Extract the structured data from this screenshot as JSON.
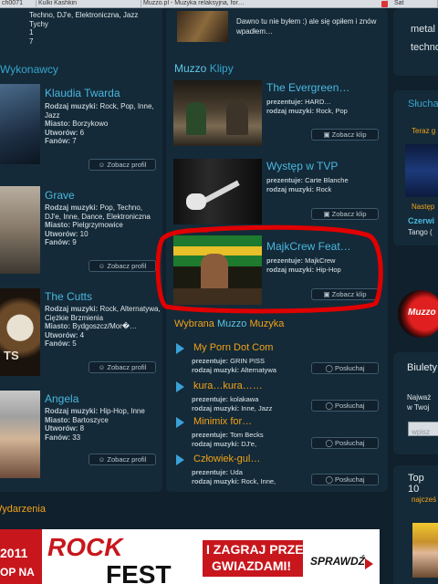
{
  "browser": {
    "tabs": [
      "ch0071",
      "Kulki Kashkin",
      "Muzzo.pl - Muzyka relaksyjna, for…",
      "Sat"
    ]
  },
  "top_left": {
    "lines": [
      "Techno, DJ'e, Elektroniczna, Jazz",
      "Tychy",
      "1",
      "7"
    ]
  },
  "top_middle": {
    "text": "Dawno tu nie byłem :) ale się opiłem i znów wpadłem…"
  },
  "right_top": {
    "lines": [
      "metal",
      "techno"
    ]
  },
  "artists": {
    "heading": "Wykonawcy",
    "items": [
      {
        "name": "Klaudia Twarda",
        "rows": [
          {
            "k": "Rodzaj muzyki:",
            "v": "Rock, Pop, Inne, Jazz"
          },
          {
            "k": "Miasto:",
            "v": "Borzykowo"
          },
          {
            "k": "Utworów:",
            "v": "6"
          },
          {
            "k": "Fanów:",
            "v": "7"
          }
        ],
        "button": "Zobacz profil"
      },
      {
        "name": "Grave",
        "rows": [
          {
            "k": "Rodzaj muzyki:",
            "v": "Pop, Techno, DJ'e, Inne, Dance, Elektroniczna"
          },
          {
            "k": "Miasto:",
            "v": "Pielgrzymowice"
          },
          {
            "k": "Utworów:",
            "v": "10"
          },
          {
            "k": "Fanów:",
            "v": "9"
          }
        ],
        "button": "Zobacz profil"
      },
      {
        "name": "The Cutts",
        "rows": [
          {
            "k": "Rodzaj muzyki:",
            "v": "Rock, Alternatywa, Ciężkie Brzmienia"
          },
          {
            "k": "Miasto:",
            "v": "Bydgoszcz/Mor�…"
          },
          {
            "k": "Utworów:",
            "v": "4"
          },
          {
            "k": "Fanów:",
            "v": "5"
          }
        ],
        "button": "Zobacz profil"
      },
      {
        "name": "Angela",
        "rows": [
          {
            "k": "Rodzaj muzyki:",
            "v": "Hip-Hop, Inne"
          },
          {
            "k": "Miasto:",
            "v": "Bartoszyce"
          },
          {
            "k": "Utworów:",
            "v": "8"
          },
          {
            "k": "Fanów:",
            "v": "33"
          }
        ],
        "button": "Zobacz profil"
      }
    ]
  },
  "clips": {
    "heading_a": "Muzzo",
    "heading_b": "Klipy",
    "items": [
      {
        "title": "The Evergreen…",
        "rows": [
          {
            "k": "prezentuje:",
            "v": "HARD…"
          },
          {
            "k": "rodzaj muzyki:",
            "v": "Rock, Pop"
          }
        ],
        "button": "Zobacz klip"
      },
      {
        "title": "Występ w TVP",
        "rows": [
          {
            "k": "prezentuje:",
            "v": "Carte Blanche"
          },
          {
            "k": "rodzaj muzyki:",
            "v": "Rock"
          }
        ],
        "button": "Zobacz klip"
      },
      {
        "title": "MajkCrew Feat…",
        "rows": [
          {
            "k": "prezentuje:",
            "v": "MajkCrew"
          },
          {
            "k": "rodzaj muzyki:",
            "v": "Hip-Hop"
          }
        ],
        "button": "Zobacz klip"
      }
    ]
  },
  "music": {
    "heading_a": "Wybrana",
    "heading_b": "Muzzo",
    "heading_c": "Muzyka",
    "items": [
      {
        "title": "My Porn Dot Com",
        "rows": [
          {
            "k": "prezentuje:",
            "v": "GRIN PISS"
          },
          {
            "k": "rodzaj muzyki:",
            "v": "Alternatywa"
          }
        ],
        "button": "Posłuchaj"
      },
      {
        "title": "kura…kura……",
        "rows": [
          {
            "k": "prezentuje:",
            "v": "kolakawa"
          },
          {
            "k": "rodzaj muzyki:",
            "v": "Inne, Jazz"
          }
        ],
        "button": "Posłuchaj"
      },
      {
        "title": "Minimix for…",
        "rows": [
          {
            "k": "prezentuje:",
            "v": "Tom Becks"
          },
          {
            "k": "rodzaj muzyki:",
            "v": "DJ'e,"
          }
        ],
        "button": "Posłuchaj"
      },
      {
        "title": "Człowiek-gul…",
        "rows": [
          {
            "k": "prezentuje:",
            "v": "Uda"
          },
          {
            "k": "rodzaj muzyki:",
            "v": "Rock, Inne,"
          }
        ],
        "button": "Posłuchaj"
      }
    ]
  },
  "right": {
    "section1": "Słuchaj",
    "now_label": "Teraz g",
    "next_label": "Następ",
    "next_line1": "Czerwi",
    "next_line2": "Tango (",
    "logo": "Muzzo",
    "newsletter_title": "Biulety",
    "newsletter_text": "Najważ w Twoj",
    "newsletter_placeholder": "wpisz",
    "top_title": "Top 10",
    "top_sub": "najcześ"
  },
  "events": {
    "heading": "Wydarzenia"
  },
  "banner": {
    "year": "2011",
    "na": "OP NA",
    "rock": "ROCK",
    "fest": "FEST",
    "zagraj1": "I ZAGRAJ PRZED",
    "zagraj2": "GWIAZDAMI!",
    "sprawdz": "SPRAWDŹ"
  },
  "colors": {
    "accent": "#4ab8e0",
    "orange": "#f2a21a",
    "highlight": "#e00000"
  }
}
